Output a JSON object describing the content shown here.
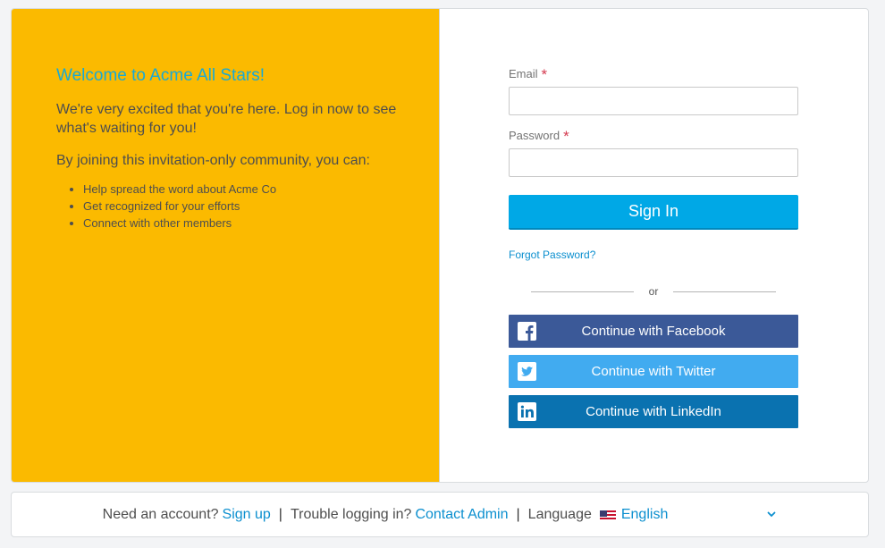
{
  "welcome": {
    "title": "Welcome to Acme All Stars!",
    "intro": "We're very excited that you're here. Log in now to see what's waiting for you!",
    "joining": "By joining this invitation-only community, you can:",
    "benefits": [
      "Help spread the word about Acme Co",
      "Get recognized for your efforts",
      "Connect with other members"
    ]
  },
  "login": {
    "email_label": "Email",
    "email_value": "",
    "password_label": "Password",
    "password_value": "",
    "required_marker": "*",
    "sign_in_label": "Sign In",
    "forgot_label": "Forgot Password?",
    "or_label": "or",
    "facebook_label": "Continue with Facebook",
    "twitter_label": "Continue with Twitter",
    "linkedin_label": "Continue with LinkedIn"
  },
  "footer": {
    "need_account": "Need an account?",
    "sign_up": "Sign up",
    "separator": "|",
    "trouble": "Trouble logging in?",
    "contact_admin": "Contact Admin",
    "language_label": "Language",
    "language_value": "English"
  },
  "colors": {
    "left_panel": "#fbba00",
    "accent": "#00a8e6",
    "facebook": "#3b5998",
    "twitter": "#41abf0",
    "linkedin": "#0a72b0"
  },
  "icons": [
    "facebook-icon",
    "twitter-icon",
    "linkedin-icon",
    "us-flag-icon",
    "chevron-down-icon"
  ]
}
